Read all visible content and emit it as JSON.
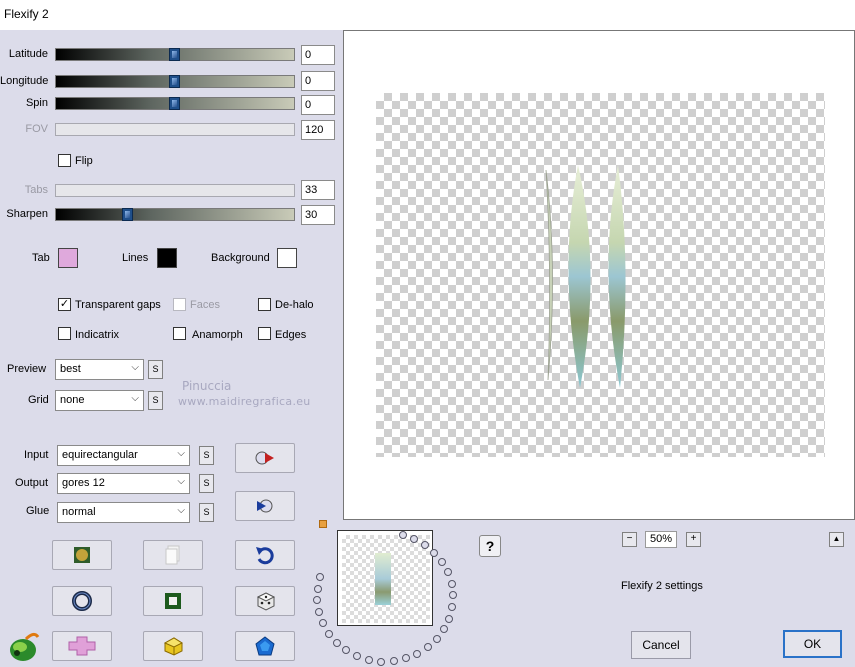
{
  "window": {
    "title": "Flexify 2"
  },
  "sliders": [
    {
      "label": "Latitude",
      "value": "0",
      "position": 0.5,
      "enabled": true
    },
    {
      "label": "Longitude",
      "value": "0",
      "position": 0.5,
      "enabled": true
    },
    {
      "label": "Spin",
      "value": "0",
      "position": 0.5,
      "enabled": true
    },
    {
      "label": "FOV",
      "value": "120",
      "position": 0,
      "enabled": false
    },
    {
      "label": "Tabs",
      "value": "33",
      "position": 0,
      "enabled": false
    },
    {
      "label": "Sharpen",
      "value": "30",
      "position": 0.3,
      "enabled": true
    }
  ],
  "checkboxes": {
    "flip": {
      "label": "Flip",
      "checked": false
    },
    "transparent_gaps": {
      "label": "Transparent gaps",
      "checked": true
    },
    "faces": {
      "label": "Faces",
      "checked": false,
      "enabled": false
    },
    "de_halo": {
      "label": "De-halo",
      "checked": false
    },
    "indicatrix": {
      "label": "Indicatrix",
      "checked": false
    },
    "anamorph": {
      "label": "Anamorph",
      "checked": false
    },
    "edges": {
      "label": "Edges",
      "checked": false
    }
  },
  "colors": {
    "tab": {
      "label": "Tab",
      "color": "#dfa9dc"
    },
    "lines": {
      "label": "Lines",
      "color": "#000000"
    },
    "background": {
      "label": "Background",
      "color": "#ffffff"
    }
  },
  "selects": {
    "preview": {
      "label": "Preview",
      "value": "best"
    },
    "grid": {
      "label": "Grid",
      "value": "none"
    },
    "input": {
      "label": "Input",
      "value": "equirectangular"
    },
    "output": {
      "label": "Output",
      "value": "gores 12"
    },
    "glue": {
      "label": "Glue",
      "value": "normal"
    }
  },
  "s_button": "S",
  "watermark": {
    "line1": "Pinuccia",
    "line2": "www.maidiregrafica.eu"
  },
  "zoom": {
    "minus": "−",
    "value": "50%",
    "plus": "+"
  },
  "help_label": "?",
  "collapse_label": "▲",
  "settings_label": "Flexify 2 settings",
  "buttons": {
    "cancel": "Cancel",
    "ok": "OK"
  }
}
